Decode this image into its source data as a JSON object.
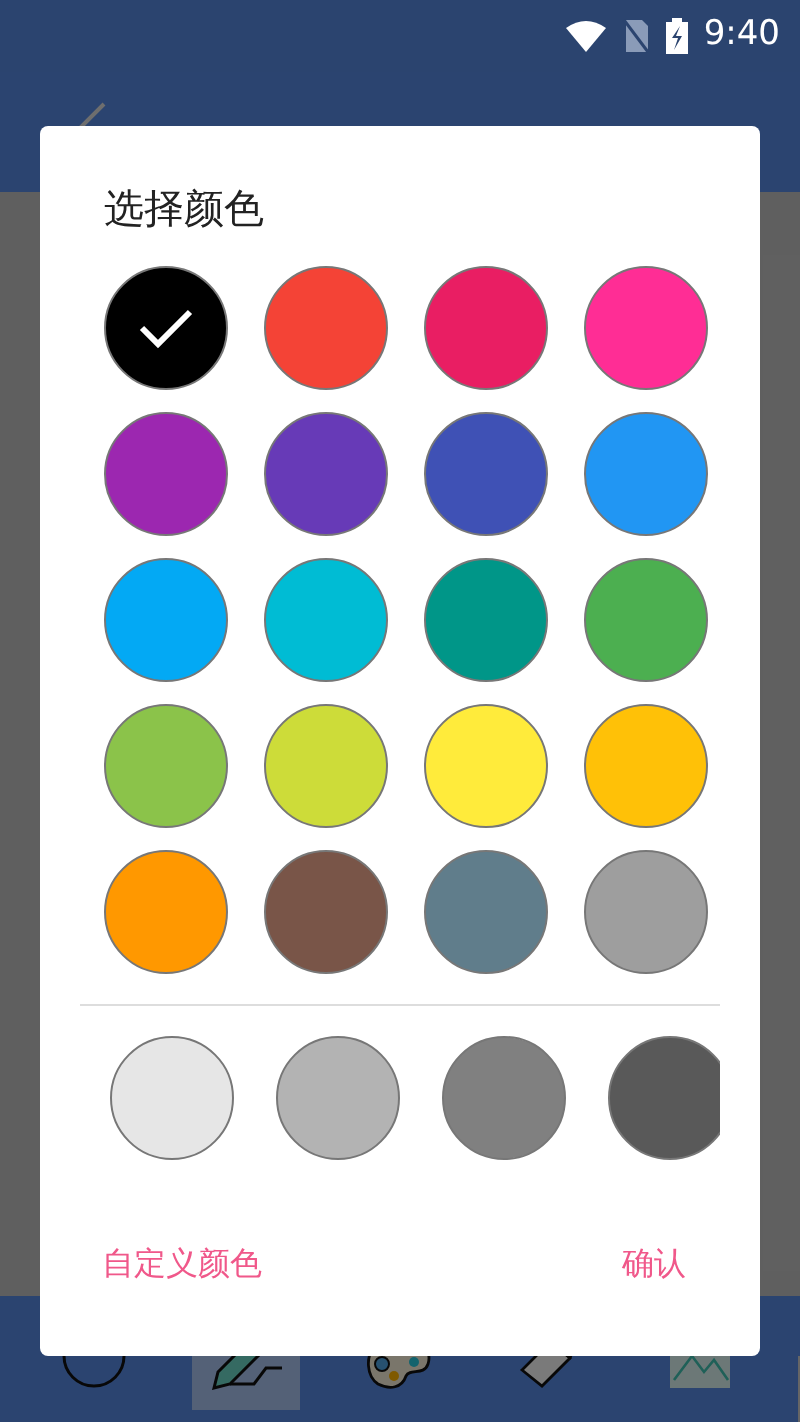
{
  "status_bar": {
    "time": "9:40"
  },
  "toolbar": {
    "tools": [
      {
        "kind": "circle",
        "selected": false
      },
      {
        "kind": "pen",
        "selected": true
      },
      {
        "kind": "palette",
        "selected": false
      },
      {
        "kind": "eraser",
        "selected": false
      },
      {
        "kind": "image",
        "selected": false
      }
    ]
  },
  "dialog": {
    "title": "选择颜色",
    "colors": [
      {
        "color": "#000000",
        "selected": true
      },
      {
        "color": "#f44336",
        "selected": false
      },
      {
        "color": "#e91e63",
        "selected": false
      },
      {
        "color": "#ff2d95",
        "selected": false
      },
      {
        "color": "#9c27b0",
        "selected": false
      },
      {
        "color": "#673ab7",
        "selected": false
      },
      {
        "color": "#3f51b5",
        "selected": false
      },
      {
        "color": "#2196f3",
        "selected": false
      },
      {
        "color": "#03a9f4",
        "selected": false
      },
      {
        "color": "#00bcd4",
        "selected": false
      },
      {
        "color": "#009688",
        "selected": false
      },
      {
        "color": "#4caf50",
        "selected": false
      },
      {
        "color": "#8bc34a",
        "selected": false
      },
      {
        "color": "#cddc39",
        "selected": false
      },
      {
        "color": "#ffeb3b",
        "selected": false
      },
      {
        "color": "#ffc107",
        "selected": false
      },
      {
        "color": "#ff9800",
        "selected": false
      },
      {
        "color": "#795548",
        "selected": false
      },
      {
        "color": "#607d8b",
        "selected": false
      },
      {
        "color": "#9e9e9e",
        "selected": false
      }
    ],
    "shades": [
      {
        "color": "#e6e6e6",
        "selected": false
      },
      {
        "color": "#b3b3b3",
        "selected": false
      },
      {
        "color": "#808080",
        "selected": false
      },
      {
        "color": "#595959",
        "selected": false
      }
    ],
    "buttons": {
      "custom": "自定义颜色",
      "confirm": "确认"
    }
  }
}
